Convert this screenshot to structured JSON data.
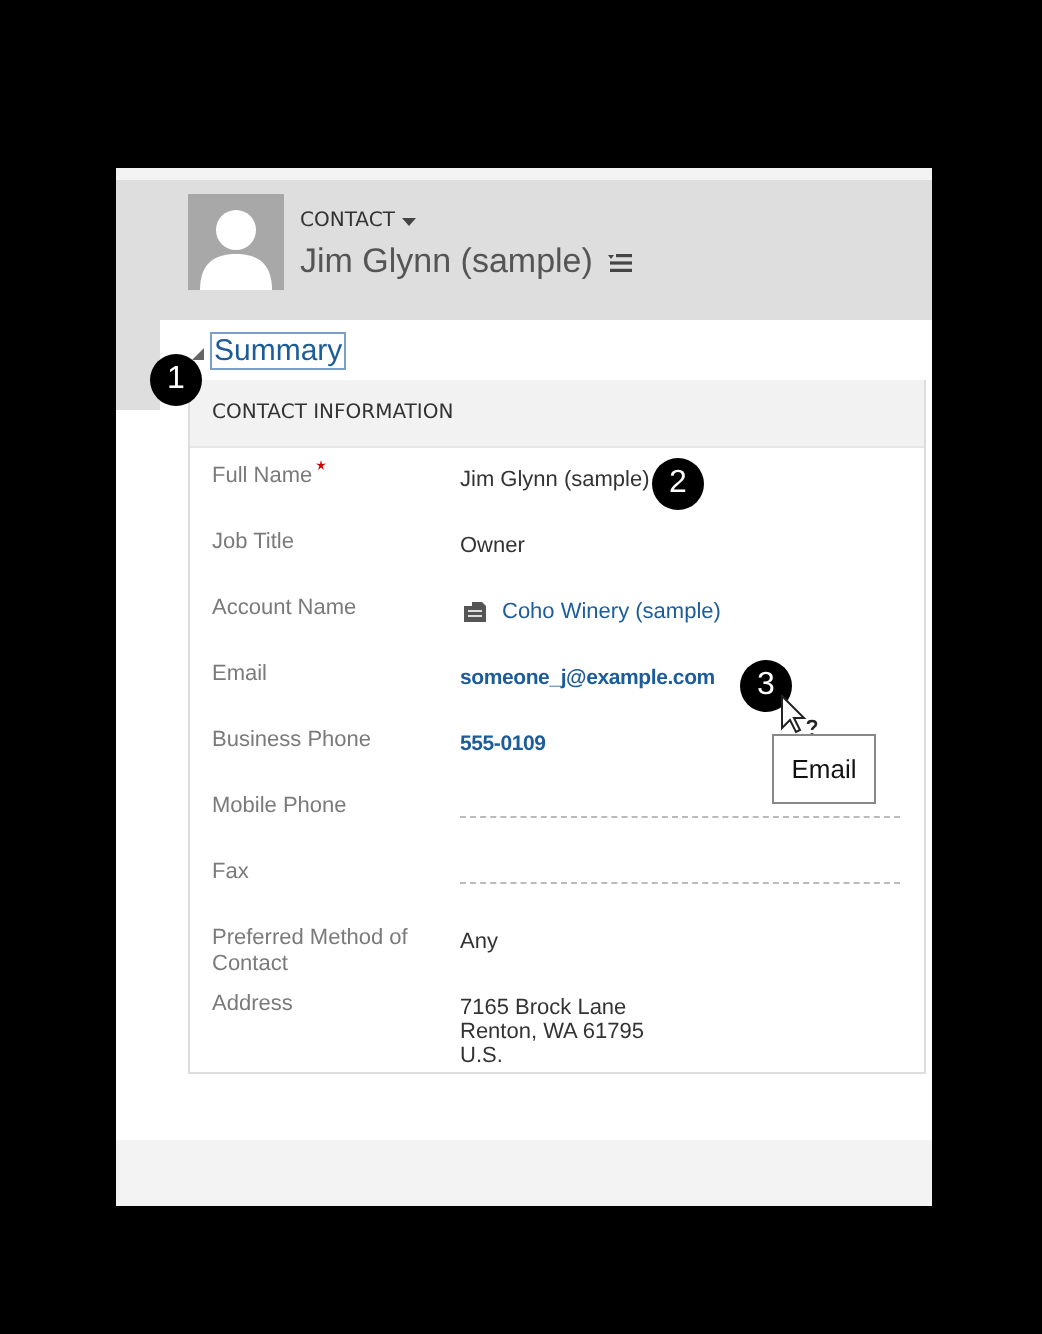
{
  "header": {
    "entity_label": "CONTACT",
    "record_name": "Jim Glynn (sample)"
  },
  "summary": {
    "label": "Summary",
    "expanded": true
  },
  "section": {
    "title": "CONTACT INFORMATION",
    "fields": [
      {
        "label": "Full Name",
        "required": true,
        "kind": "text",
        "value": "Jim Glynn (sample)"
      },
      {
        "label": "Job Title",
        "required": false,
        "kind": "text",
        "value": "Owner"
      },
      {
        "label": "Account Name",
        "required": false,
        "kind": "lookup",
        "value": "Coho Winery (sample)"
      },
      {
        "label": "Email",
        "required": false,
        "kind": "link",
        "value": "someone_j@example.com"
      },
      {
        "label": "Business Phone",
        "required": false,
        "kind": "link",
        "value": "555-0109"
      },
      {
        "label": "Mobile Phone",
        "required": false,
        "kind": "empty"
      },
      {
        "label": "Fax",
        "required": false,
        "kind": "empty"
      },
      {
        "label": "Preferred Method of Contact",
        "required": false,
        "kind": "text",
        "value": "Any"
      },
      {
        "label": "Address",
        "required": false,
        "kind": "multiline",
        "lines": [
          "7165 Brock Lane",
          "Renton, WA 61795",
          "U.S."
        ]
      }
    ]
  },
  "callouts": [
    {
      "number": "1"
    },
    {
      "number": "2"
    },
    {
      "number": "3"
    }
  ],
  "tooltip": {
    "text": "Email"
  }
}
